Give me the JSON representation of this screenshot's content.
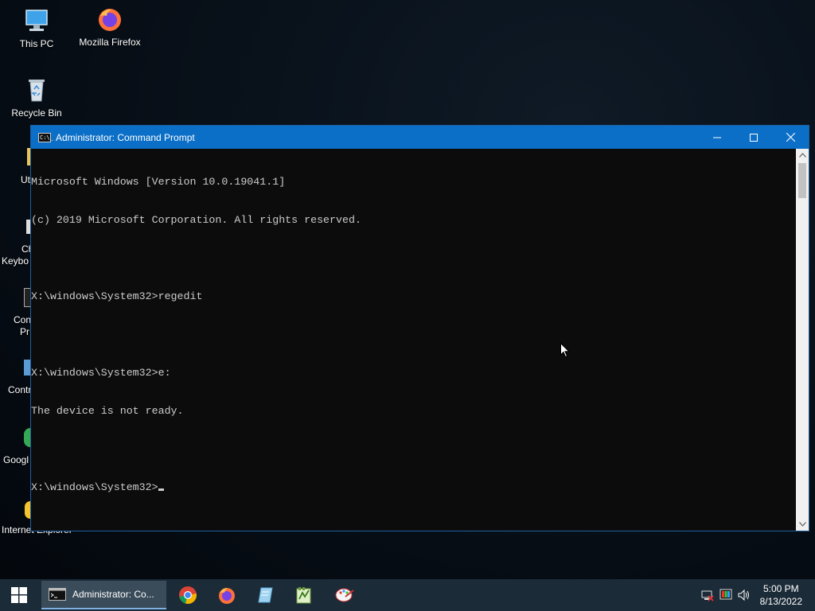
{
  "desktop": {
    "icons": [
      {
        "label": "This PC",
        "icon": "this-pc-icon"
      },
      {
        "label": "Mozilla Firefox",
        "icon": "firefox-icon"
      },
      {
        "label": "Recycle Bin",
        "icon": "recycle-bin-icon"
      }
    ],
    "partial_labels": {
      "utilities": "Uti",
      "keyboard_1": "Ch",
      "keyboard_2": "Keybo",
      "console_1": "Con",
      "console_2": "Pr",
      "control": "Contr",
      "google": "Googl",
      "ie": "Internet Explorer"
    }
  },
  "window": {
    "title": "Administrator: Command Prompt",
    "app_icon_text": "C:\\_",
    "controls": {
      "minimize": "minimize-icon",
      "maximize": "maximize-icon",
      "close": "close-icon"
    },
    "console_lines": [
      "Microsoft Windows [Version 10.0.19041.1]",
      "(c) 2019 Microsoft Corporation. All rights reserved.",
      "",
      "X:\\windows\\System32>regedit",
      "",
      "X:\\windows\\System32>e:",
      "The device is not ready.",
      "",
      "X:\\windows\\System32>"
    ]
  },
  "taskbar": {
    "active_task_label": "Administrator: Co...",
    "pinned": [
      "chrome-icon",
      "firefox-icon",
      "notepad-icon",
      "notepad-plus-icon",
      "paint-icon"
    ],
    "tray": [
      "network-disconnected-icon",
      "display-icon",
      "volume-icon"
    ],
    "clock": {
      "time": "5:00 PM",
      "date": "8/13/2022"
    }
  },
  "colors": {
    "titlebar": "#0b6fc7",
    "console_bg": "#0c0c0c",
    "console_text": "#cccccc",
    "taskbar": "#1c2b38"
  }
}
